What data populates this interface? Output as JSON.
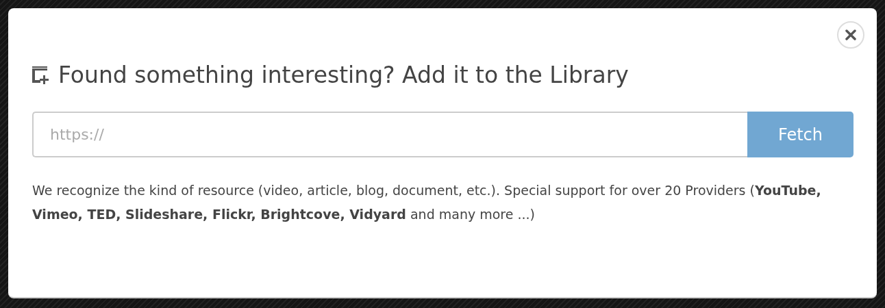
{
  "dialog": {
    "title": "Found something interesting? Add it to the Library",
    "url_field": {
      "placeholder": "https://"
    },
    "fetch_button": "Fetch",
    "description": "We recognize the kind of resource (video, article, blog, document, etc.). Special support for over 20 Providers (**YouTube, Vimeo, TED, Slideshare, Flickr, Brightcove, Vidyard** and many more ...)"
  }
}
